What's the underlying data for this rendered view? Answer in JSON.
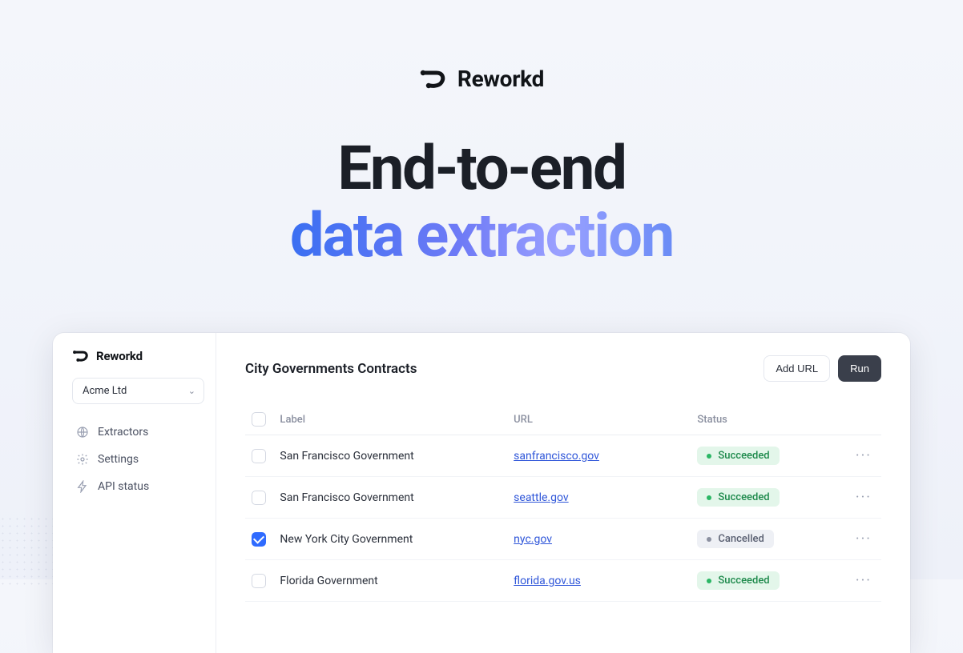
{
  "brand": {
    "name": "Reworkd"
  },
  "hero": {
    "line1": "End-to-end",
    "line2": "data extraction"
  },
  "sidebar": {
    "brand": "Reworkd",
    "org": "Acme Ltd",
    "items": [
      {
        "label": "Extractors",
        "icon": "globe-icon"
      },
      {
        "label": "Settings",
        "icon": "gear-icon"
      },
      {
        "label": "API status",
        "icon": "bolt-icon"
      }
    ]
  },
  "main": {
    "title": "City Governments Contracts",
    "buttons": {
      "add_url": "Add URL",
      "run": "Run"
    },
    "columns": {
      "label": "Label",
      "url": "URL",
      "status": "Status"
    },
    "rows": [
      {
        "label": "San Francisco Government",
        "url": "sanfrancisco.gov",
        "status": "Succeeded",
        "status_kind": "success",
        "checked": false
      },
      {
        "label": "San Francisco Government",
        "url": "seattle.gov",
        "status": "Succeeded",
        "status_kind": "success",
        "checked": false
      },
      {
        "label": "New York City Government",
        "url": "nyc.gov",
        "status": "Cancelled",
        "status_kind": "muted",
        "checked": true
      },
      {
        "label": "Florida Government",
        "url": "florida.gov.us",
        "status": "Succeeded",
        "status_kind": "success",
        "checked": false
      }
    ]
  }
}
